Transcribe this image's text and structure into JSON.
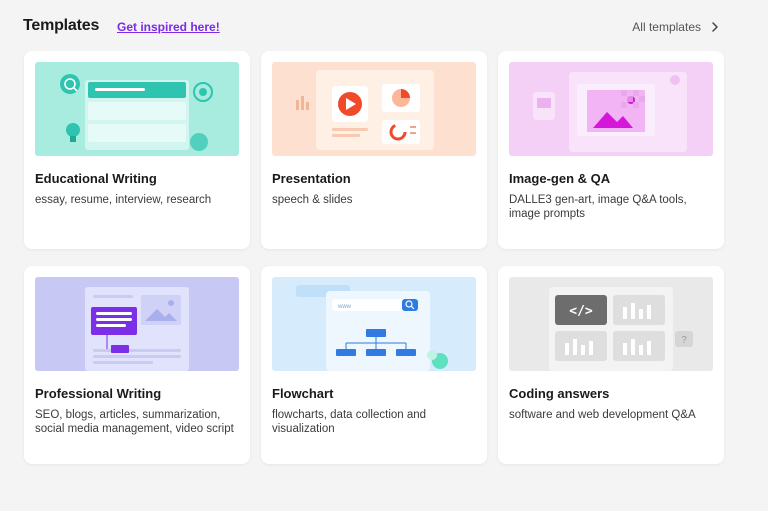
{
  "header": {
    "title": "Templates",
    "inspired_link": "Get inspired here!",
    "all_templates": "All templates"
  },
  "cards": [
    {
      "title": "Educational Writing",
      "desc": "essay, resume, interview, research",
      "icon": "educational-writing-illustration",
      "thumb_color": "#a8ecdf"
    },
    {
      "title": "Presentation",
      "desc": "speech & slides",
      "icon": "presentation-illustration",
      "thumb_color": "#fde0cf"
    },
    {
      "title": "Image-gen & QA",
      "desc": "DALLE3 gen-art, image Q&A tools, image prompts",
      "icon": "image-gen-illustration",
      "thumb_color": "#f4cff6"
    },
    {
      "title": "Professional Writing",
      "desc": "SEO, blogs, articles, summarization, social media management, video script",
      "icon": "professional-writing-illustration",
      "thumb_color": "#c7c8f4"
    },
    {
      "title": "Flowchart",
      "desc": "flowcharts, data collection and visualization",
      "icon": "flowchart-illustration",
      "thumb_color": "#d6ebfb"
    },
    {
      "title": "Coding answers",
      "desc": "software and web development Q&A",
      "icon": "code-illustration",
      "thumb_color": "#e9e9e9"
    }
  ]
}
